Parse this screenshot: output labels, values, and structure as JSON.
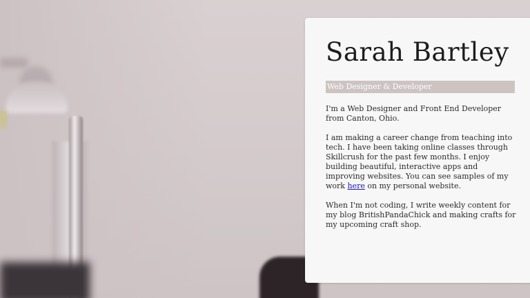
{
  "profile": {
    "name": "Sarah Bartley",
    "role": "Web Designer & Developer",
    "intro": "I'm a Web Designer and Front End Developer from Canton, Ohio.",
    "career_pre": "I am making a career change from teaching into tech. I have been taking online classes through Skillcrush for the past few months. I enjoy building beautiful, interactive apps and improving websites. You can see samples of my work ",
    "career_link": "here",
    "career_post": " on my personal website.",
    "hobbies": "When I'm not coding, I write weekly content for my blog BritishPandaChick and making crafts for my upcoming craft shop."
  },
  "colors": {
    "card_background": "#f7f7f7",
    "role_bar": "#cdc4c2",
    "link": "#1a1aa8",
    "page_background": "#d6cdcf"
  }
}
